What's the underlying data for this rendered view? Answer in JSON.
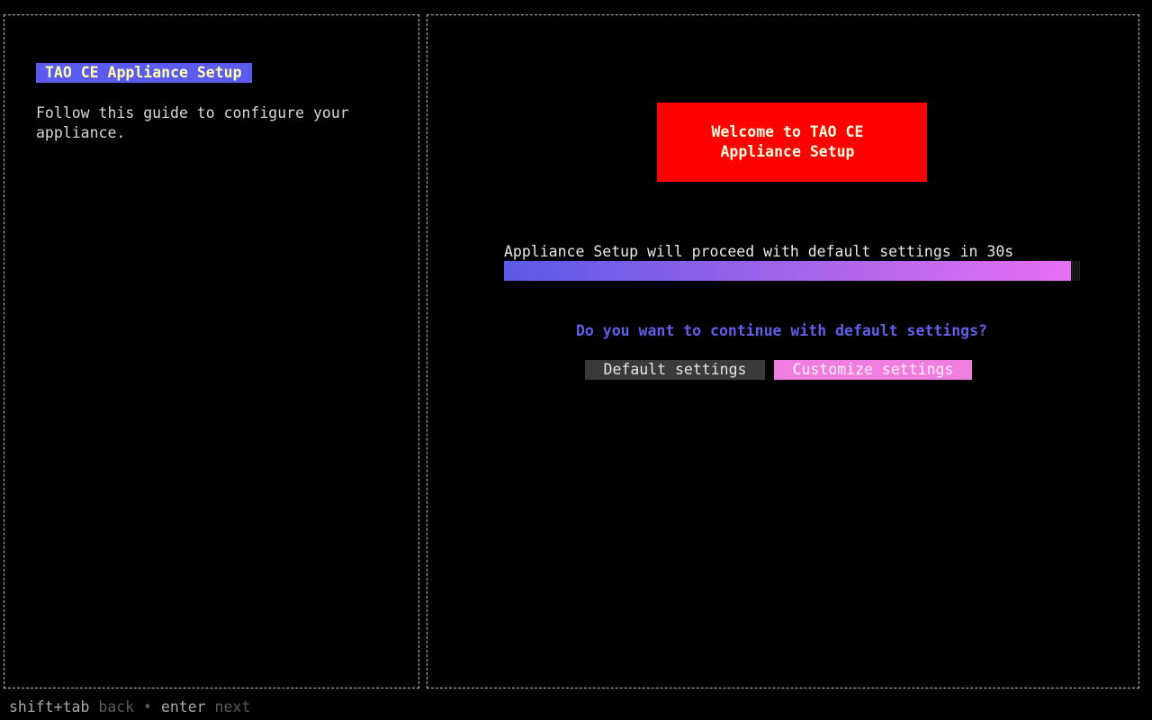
{
  "sidebar": {
    "title": "TAO CE Appliance Setup",
    "description": "Follow this guide to configure your appliance."
  },
  "main": {
    "welcome": "Welcome to TAO CE Appliance Setup",
    "countdown": "Appliance Setup will proceed with default settings in 30s",
    "progress_fraction": 0.984,
    "question": "Do you want to continue with default settings?",
    "buttons": {
      "default": "Default settings",
      "customize": "Customize settings"
    }
  },
  "footer": {
    "back_key": "shift+tab",
    "back_label": "back",
    "separator": "•",
    "next_key": "enter",
    "next_label": "next"
  },
  "colors": {
    "title_bg": "#5b5bf0",
    "welcome_bg": "#ff0000",
    "question": "#5f5fe8",
    "default_button_bg": "#3a3a3a",
    "customize_button_bg": "#f07ee0"
  }
}
